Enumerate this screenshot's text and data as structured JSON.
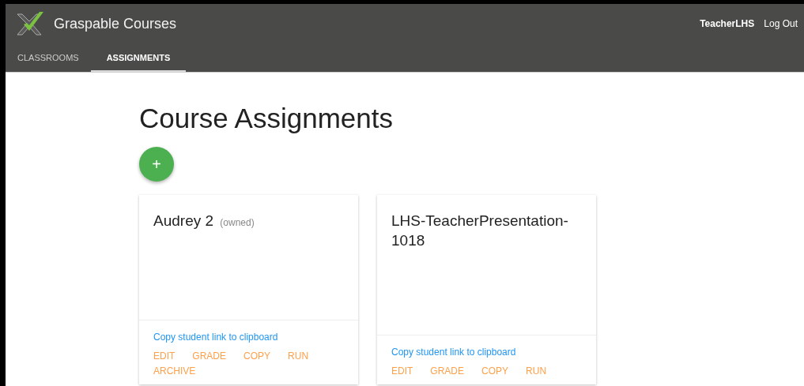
{
  "app": {
    "title": "Graspable Courses",
    "user": "TeacherLHS",
    "logout": "Log Out"
  },
  "tabs": [
    {
      "label": "CLASSROOMS",
      "selected": false
    },
    {
      "label": "ASSIGNMENTS",
      "selected": true
    }
  ],
  "page": {
    "heading": "Course Assignments",
    "add_button": "+"
  },
  "cards": [
    {
      "title": "Audrey 2",
      "note": "(owned)",
      "link": "Copy student link to clipboard",
      "actions": [
        "EDIT",
        "GRADE",
        "COPY",
        "RUN",
        "ARCHIVE"
      ]
    },
    {
      "title": "LHS-TeacherPresentation-1018",
      "link": "Copy student link to clipboard",
      "actions": [
        "EDIT",
        "GRADE",
        "COPY",
        "RUN"
      ]
    }
  ]
}
